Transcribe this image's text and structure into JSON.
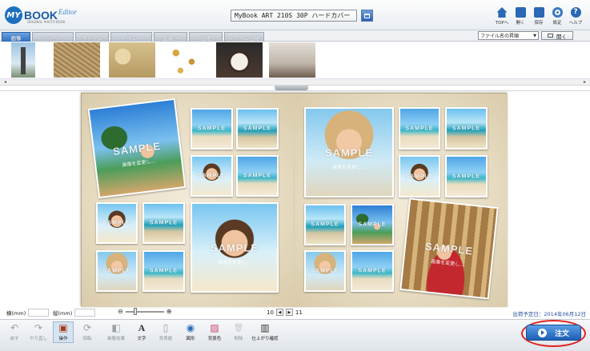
{
  "app": {
    "logo_my": "MY",
    "logo_book": "BOOK",
    "logo_editor": "Editor",
    "logo_sub": "ORIGINAL PHOTO BOOK"
  },
  "header": {
    "book_title": "MyBook ART 210S 30P ハードカバー",
    "nav": [
      {
        "icon": "home-icon",
        "label": "TOPへ"
      },
      {
        "icon": "folder-icon",
        "label": "開く"
      },
      {
        "icon": "save-icon",
        "label": "保存"
      },
      {
        "icon": "gear-icon",
        "label": "設定"
      },
      {
        "icon": "help-icon",
        "label": "ヘルプ",
        "glyph": "?"
      }
    ]
  },
  "tabs": [
    {
      "label": "画像",
      "active": true
    },
    {
      "label": "ページ",
      "active": false
    },
    {
      "label": "ボックス",
      "active": false
    },
    {
      "label": "イラスト",
      "active": false
    },
    {
      "label": "型抜き",
      "active": false
    },
    {
      "label": "台紙",
      "active": false
    },
    {
      "label": "デザイン台紙",
      "active": false
    }
  ],
  "sort": {
    "value": "ファイル名の昇順",
    "arrow": "▼"
  },
  "open_button": {
    "label": "開く"
  },
  "scroll": {
    "left": "◂",
    "right": "▸"
  },
  "spread": {
    "watermark": "SAMPLE",
    "caption": "画像を変更し..."
  },
  "status": {
    "width_label": "横(mm)",
    "height_label": "縦(mm)",
    "zoom_minus": "⊖",
    "zoom_plus": "⊕",
    "page_left": "10",
    "page_right": "11",
    "ship_date": "出荷予定日：2014年06月12日"
  },
  "toolbar": [
    {
      "icon": "undo-icon",
      "glyph": "↶",
      "label": "戻す",
      "enabled": false
    },
    {
      "icon": "redo-icon",
      "glyph": "↷",
      "label": "やり直し",
      "enabled": false
    },
    {
      "icon": "operate-icon",
      "glyph": "▣",
      "label": "操作",
      "enabled": true,
      "selected": true
    },
    {
      "icon": "rotate-icon",
      "glyph": "⟳",
      "label": "回転",
      "enabled": false
    },
    {
      "icon": "image-effect-icon",
      "glyph": "◧",
      "label": "画像効果",
      "enabled": false
    },
    {
      "icon": "text-icon",
      "glyph": "A",
      "label": "文字",
      "enabled": true
    },
    {
      "icon": "background-frame-icon",
      "glyph": "▯",
      "label": "背表紙",
      "enabled": false
    },
    {
      "icon": "shape-icon",
      "glyph": "◉",
      "label": "図形",
      "enabled": true
    },
    {
      "icon": "background-color-icon",
      "glyph": "▨",
      "label": "背景色",
      "enabled": true
    },
    {
      "icon": "delete-icon",
      "glyph": "🗑",
      "label": "削除",
      "enabled": false
    },
    {
      "icon": "preview-icon",
      "glyph": "▥",
      "label": "仕上がり確認",
      "enabled": true
    }
  ],
  "order_button": {
    "label": "注文"
  },
  "colors": {
    "accent": "#1c5fb5",
    "highlight": "#e12020"
  }
}
